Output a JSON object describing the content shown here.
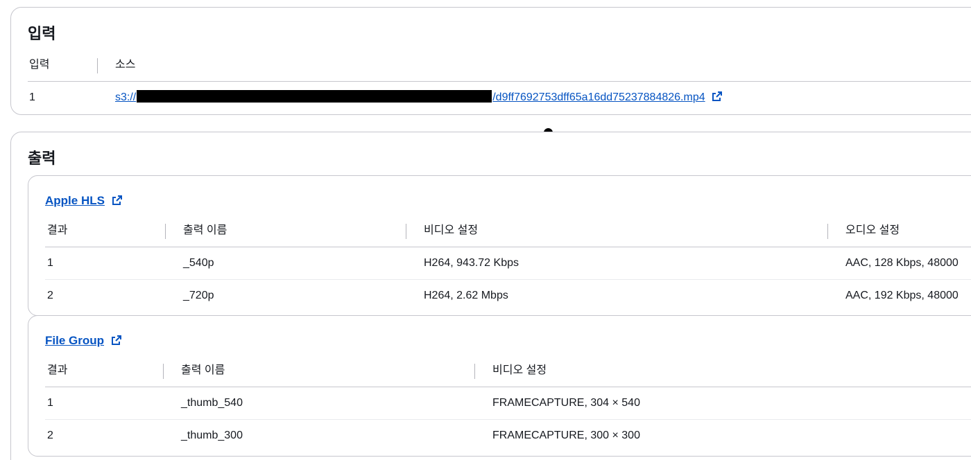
{
  "input_panel": {
    "title": "입력",
    "headers": [
      "입력",
      "소스"
    ],
    "rows": [
      {
        "index": "1",
        "source_prefix": "s3://",
        "source_suffix": "/d9ff7692753dff65a16dd75237884826.mp4"
      }
    ]
  },
  "output_panel": {
    "title": "출력",
    "groups": [
      {
        "title": "Apple HLS",
        "headers": [
          "결과",
          "출력 이름",
          "비디오 설정",
          "오디오 설정"
        ],
        "rows": [
          [
            "1",
            "_540p",
            "H264, 943.72 Kbps",
            "AAC, 128 Kbps, 48000"
          ],
          [
            "2",
            "_720p",
            "H264, 2.62 Mbps",
            "AAC, 192 Kbps, 48000"
          ]
        ]
      },
      {
        "title": "File Group",
        "headers": [
          "결과",
          "출력 이름",
          "비디오 설정"
        ],
        "rows": [
          [
            "1",
            "_thumb_540",
            "FRAMECAPTURE, 304 × 540"
          ],
          [
            "2",
            "_thumb_300",
            "FRAMECAPTURE, 300 × 300"
          ]
        ]
      }
    ]
  },
  "icons": {
    "external_link": "external-link-icon"
  },
  "colors": {
    "link": "#0654c2",
    "border": "#c6c6cd",
    "text": "#16191f"
  }
}
